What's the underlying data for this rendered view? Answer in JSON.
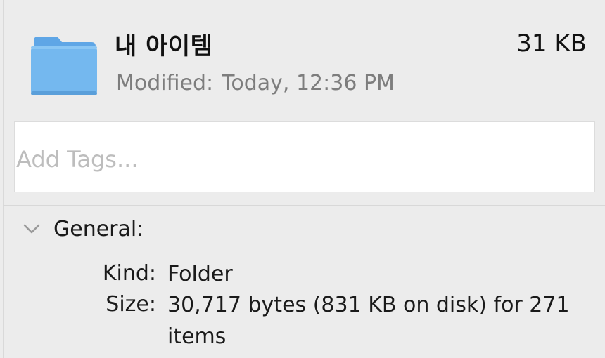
{
  "header": {
    "name": "내 아이템",
    "size": "31 KB",
    "modified_label": "Modified:",
    "modified_value": "Today, 12:36 PM",
    "icon": "folder-icon",
    "icon_color": "#6fb3ec"
  },
  "tags": {
    "placeholder": "Add Tags..."
  },
  "general": {
    "label": "General:",
    "icon": "chevron-down-icon",
    "rows": [
      {
        "key": "Kind:",
        "value": "Folder"
      },
      {
        "key": "Size:",
        "value": "30,717 bytes (831 KB on disk) for 271 items"
      }
    ]
  }
}
